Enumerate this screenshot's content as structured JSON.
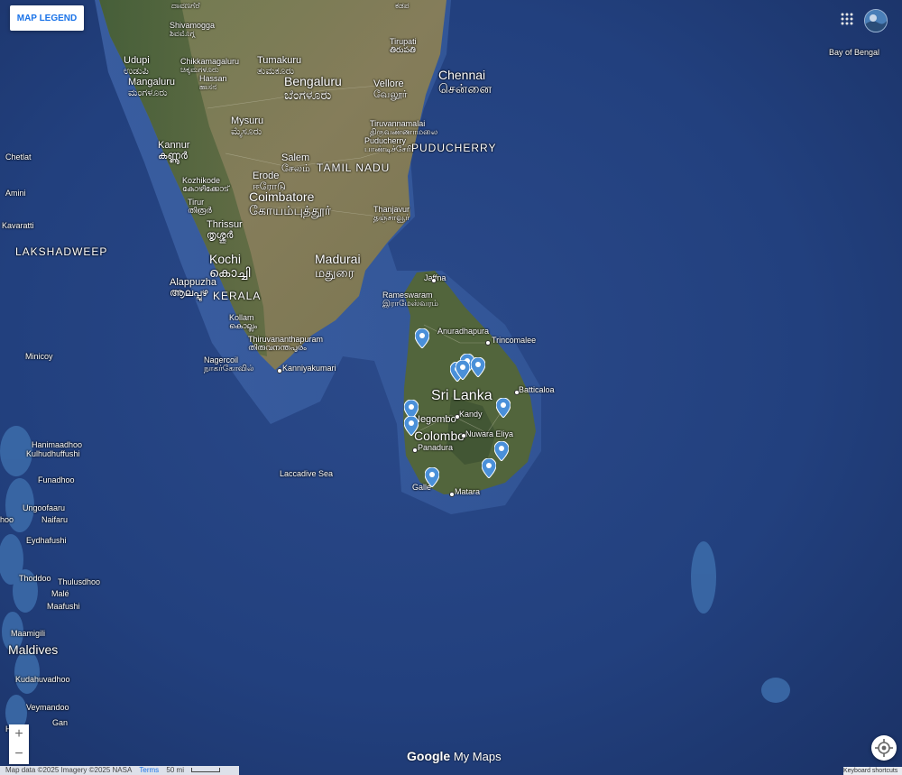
{
  "legend_button": "MAP LEGEND",
  "place_labels": {
    "shivamogga_en": "Shivamogga",
    "shivamogga_kn": "ಶಿವಮೊಗ್ಗ",
    "udupi_en": "Udupi",
    "udupi_kn": "ಉಡುಪಿ",
    "chikkamagaluru_en": "Chikkamagaluru",
    "chikkamagaluru_kn": "ಚಿಕ್ಕಮಗಳೂರು",
    "hassan_en": "Hassan",
    "hassan_kn": "ಹಾಸನ",
    "tumakuru_en": "Tumakuru",
    "tumakuru_kn": "ತುಮಕೂರು",
    "bengaluru_en": "Bengaluru",
    "bengaluru_kn": "ಬೆಂಗಳೂರು",
    "tirupati_en": "Tirupati",
    "tirupati_te": "తిరుపతి",
    "chennai_en": "Chennai",
    "chennai_ta": "சென்னை",
    "vellore_en": "Vellore",
    "vellore_ta": "வேலூர்",
    "mangaluru_en": "Mangaluru",
    "mangaluru_kn": "ಮಂಗಳೂರು",
    "mysuru_en": "Mysuru",
    "mysuru_kn": "ಮೈಸೂರು",
    "tiruvannamalai_en": "Tiruvannamalai",
    "tiruvannamalai_ta": "திருவண்ணாமலை",
    "puducherry_en": "Puducherry",
    "puducherry_ta": "பாண்டிச்சேரி",
    "puducherry_region": "PUDUCHERRY",
    "kannur_en": "Kannur",
    "kannur_ml": "കണ്ണൂർ",
    "chetlat": "Chetlat",
    "salem_en": "Salem",
    "salem_ta": "சேலம்",
    "tamil_nadu": "TAMIL NADU",
    "kozhikode_en": "Kozhikode",
    "kozhikode_ml": "കോഴിക്കോട്",
    "erode_en": "Erode",
    "erode_ta": "ஈரோடு",
    "amini": "Amini",
    "coimbatore_en": "Coimbatore",
    "coimbatore_ta": "கோயம்புத்தூர்",
    "tirur_en": "Tirur",
    "tirur_ml": "തിരൂർ",
    "kavaratti": "Kavaratti",
    "thrissur_en": "Thrissur",
    "thrissur_ml": "തൃശ്ശൂർ",
    "thanjavur_en": "Thanjavur",
    "thanjavur_ta": "தஞ்சாவூர்",
    "lakshadweep": "LAKSHADWEEP",
    "kochi_en": "Kochi",
    "kochi_ml": "കൊച്ചി",
    "madurai_en": "Madurai",
    "madurai_ta": "மதுரை",
    "jaffna": "Jaffna",
    "alappuzha_en": "Alappuzha",
    "alappuzha_ml": "ആലപ്പുഴ",
    "kerala": "KERALA",
    "rameswaram_en": "Rameswaram",
    "rameswaram_ta": "இராமேஸ்வரம்",
    "kollam_en": "Kollam",
    "kollam_ml": "കൊല്ലം",
    "thiruvananthapuram_en": "Thiruvananthapuram",
    "thiruvananthapuram_ml": "തിരുവനന്തപുരം",
    "anuradhapura": "Anuradhapura",
    "trincomalee": "Trincomalee",
    "minicoy": "Minicoy",
    "nagercoil_en": "Nagercoil",
    "nagercoil_ta": "நாகர்கோவில்",
    "kanniyakumari": "Kanniyakumari",
    "sri_lanka": "Sri Lanka",
    "batticaloa": "Batticaloa",
    "negombo": "Negombo",
    "kandy": "Kandy",
    "colombo": "Colombo",
    "nuwara_eliya": "Nuwara Eliya",
    "panadura": "Panadura",
    "hanimaadhoo": "Hanimaadhoo",
    "kulhudhuffushi": "Kulhudhuffushi",
    "laccadive_sea": "Laccadive Sea",
    "funadhoo": "Funadhoo",
    "galle": "Galle",
    "matara": "Matara",
    "ungoofaaru": "Ungoofaaru",
    "naifaru": "Naifaru",
    "eydhafushi": "Eydhafushi",
    "thoddoo": "Thoddoo",
    "thulusdhoo": "Thulusdhoo",
    "male": "Malé",
    "maafushi": "Maafushi",
    "maamigili": "Maamigili",
    "maldives": "Maldives",
    "kudahuvadhoo": "Kudahuvadhoo",
    "veymandoo": "Veymandoo",
    "gan": "Gan",
    "bay_of_bengal": "Bay of Bengal",
    "top_cut_kn": "ದಾವಣಗೆರೆ",
    "top_cut_te": "ಕಡಪ",
    "left_hoo": "hoo",
    "left_h": "H"
  },
  "markers": [
    {
      "name": "marker-1"
    },
    {
      "name": "marker-2"
    },
    {
      "name": "marker-3"
    },
    {
      "name": "marker-4"
    },
    {
      "name": "marker-5"
    },
    {
      "name": "marker-6"
    },
    {
      "name": "marker-7"
    },
    {
      "name": "marker-8"
    },
    {
      "name": "marker-9"
    },
    {
      "name": "marker-10"
    },
    {
      "name": "marker-11"
    }
  ],
  "marker_color": "#4a90d9",
  "zoom_in": "+",
  "zoom_out": "−",
  "footer": {
    "attribution": "Map data ©2025 Imagery ©2025 NASA",
    "terms": "Terms",
    "scale": "50 mi"
  },
  "keyboard_shortcuts": "Keyboard shortcuts",
  "brand": {
    "google": "Google",
    "mymaps": " My Maps"
  },
  "icons": {
    "apps": "apps-grid-icon",
    "avatar": "user-avatar",
    "locate": "my-location-icon"
  }
}
